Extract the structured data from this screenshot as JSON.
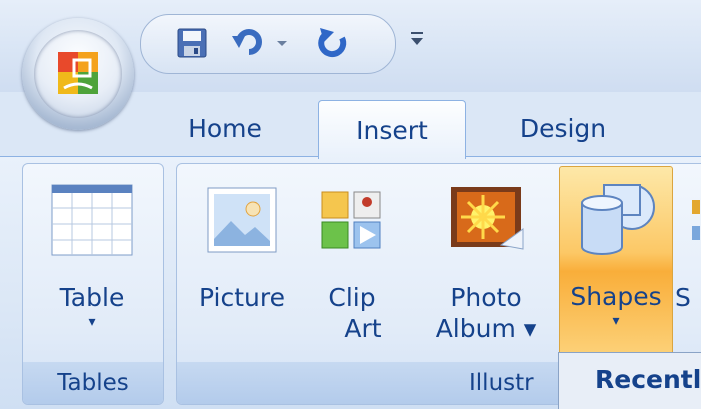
{
  "qat": {
    "icons": [
      "office-button-icon",
      "save-icon",
      "undo-icon",
      "dropdown-arrow-icon",
      "redo-icon",
      "customize-qat-icon"
    ]
  },
  "tabs": [
    {
      "label": "Home",
      "active": false
    },
    {
      "label": "Insert",
      "active": true
    },
    {
      "label": "Design",
      "active": false
    }
  ],
  "ribbon": {
    "groups": [
      {
        "label": "Tables",
        "buttons": [
          {
            "line1": "Table",
            "line2": "",
            "arrow": "▾"
          }
        ]
      },
      {
        "label": "Illustr",
        "buttons": [
          {
            "line1": "Picture",
            "line2": "",
            "arrow": ""
          },
          {
            "line1": "Clip",
            "line2": "Art",
            "arrow": ""
          },
          {
            "line1": "Photo",
            "line2": "Album ▾",
            "arrow": ""
          },
          {
            "line1": "Shapes",
            "line2": "",
            "arrow": "▾"
          },
          {
            "line1": "S",
            "line2": "",
            "arrow": ""
          }
        ]
      }
    ]
  },
  "dropdown": {
    "header": "Recentl"
  },
  "colors": {
    "accent": "#15428b",
    "hover": "#fcc866"
  }
}
